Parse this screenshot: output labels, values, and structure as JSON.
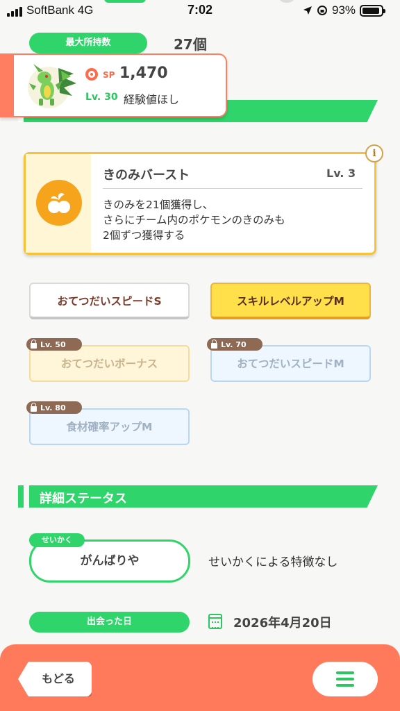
{
  "status_bar": {
    "carrier": "SoftBank  4G",
    "time": "7:02",
    "battery": "93%",
    "battery_level": 0.93
  },
  "hold": {
    "label": "最大所持数",
    "value": "27個"
  },
  "pokemon": {
    "sp_label": "SP",
    "sp_value": "1,470",
    "level": "Lv. 30",
    "status": "経験値ほし"
  },
  "skill": {
    "name": "きのみバースト",
    "level": "Lv. 3",
    "description": "きのみを21個獲得し、\nさらにチーム内のポケモンのきのみも\n2個ずつ獲得する",
    "info": "i"
  },
  "subskills": [
    {
      "label": "おてつだいスピードS"
    },
    {
      "label": "スキルレベルアップM"
    },
    {
      "label": "おてつだいボーナス",
      "lock": "Lv. 50"
    },
    {
      "label": "おてつだいスピードM",
      "lock": "Lv. 70"
    },
    {
      "label": "食材確率アップM",
      "lock": "Lv. 80"
    }
  ],
  "details": {
    "title": "詳細ステータス",
    "nature_tag": "せいかく",
    "nature": "がんばりや",
    "nature_desc": "せいかくによる特徴なし",
    "met_label": "出会った日",
    "met_date": "2026年4月20日"
  },
  "nav": {
    "back": "もどる"
  },
  "colors": {
    "green": "#2fd46a",
    "orange": "#ff7a5a",
    "gold": "#f5c23a"
  }
}
